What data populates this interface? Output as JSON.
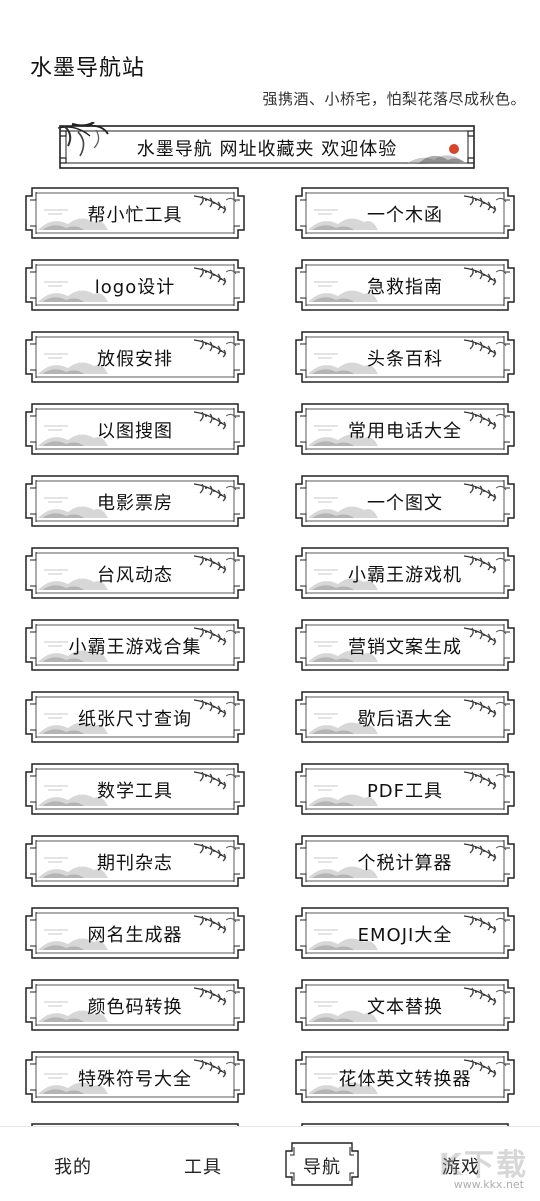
{
  "header": {
    "title": "水墨导航站",
    "subtitle": "强携酒、小桥宅，怕梨花落尽成秋色。"
  },
  "banner": {
    "text": "水墨导航 网址收藏夹 欢迎体验"
  },
  "nav_cards": [
    {
      "label": "帮小忙工具"
    },
    {
      "label": "一个木函"
    },
    {
      "label": "logo设计"
    },
    {
      "label": "急救指南"
    },
    {
      "label": "放假安排"
    },
    {
      "label": "头条百科"
    },
    {
      "label": "以图搜图"
    },
    {
      "label": "常用电话大全"
    },
    {
      "label": "电影票房"
    },
    {
      "label": "一个图文"
    },
    {
      "label": "台风动态"
    },
    {
      "label": "小霸王游戏机"
    },
    {
      "label": "小霸王游戏合集"
    },
    {
      "label": "营销文案生成"
    },
    {
      "label": "纸张尺寸查询"
    },
    {
      "label": "歇后语大全"
    },
    {
      "label": "数学工具"
    },
    {
      "label": "PDF工具"
    },
    {
      "label": "期刊杂志"
    },
    {
      "label": "个税计算器"
    },
    {
      "label": "网名生成器"
    },
    {
      "label": "EMOJI大全"
    },
    {
      "label": "颜色码转换"
    },
    {
      "label": "文本替换"
    },
    {
      "label": "特殊符号大全"
    },
    {
      "label": "花体英文转换器"
    }
  ],
  "bottom_nav": {
    "items": [
      {
        "label": "我的"
      },
      {
        "label": "工具"
      },
      {
        "label": "导航",
        "active": true
      },
      {
        "label": "游戏"
      }
    ]
  },
  "watermark": {
    "brand": "K下载",
    "url": "www.kkx.net"
  },
  "colors": {
    "ink": "#1a1a1a",
    "sun_red": "#d8442a",
    "mountain_gray": "#bdbdbd"
  }
}
